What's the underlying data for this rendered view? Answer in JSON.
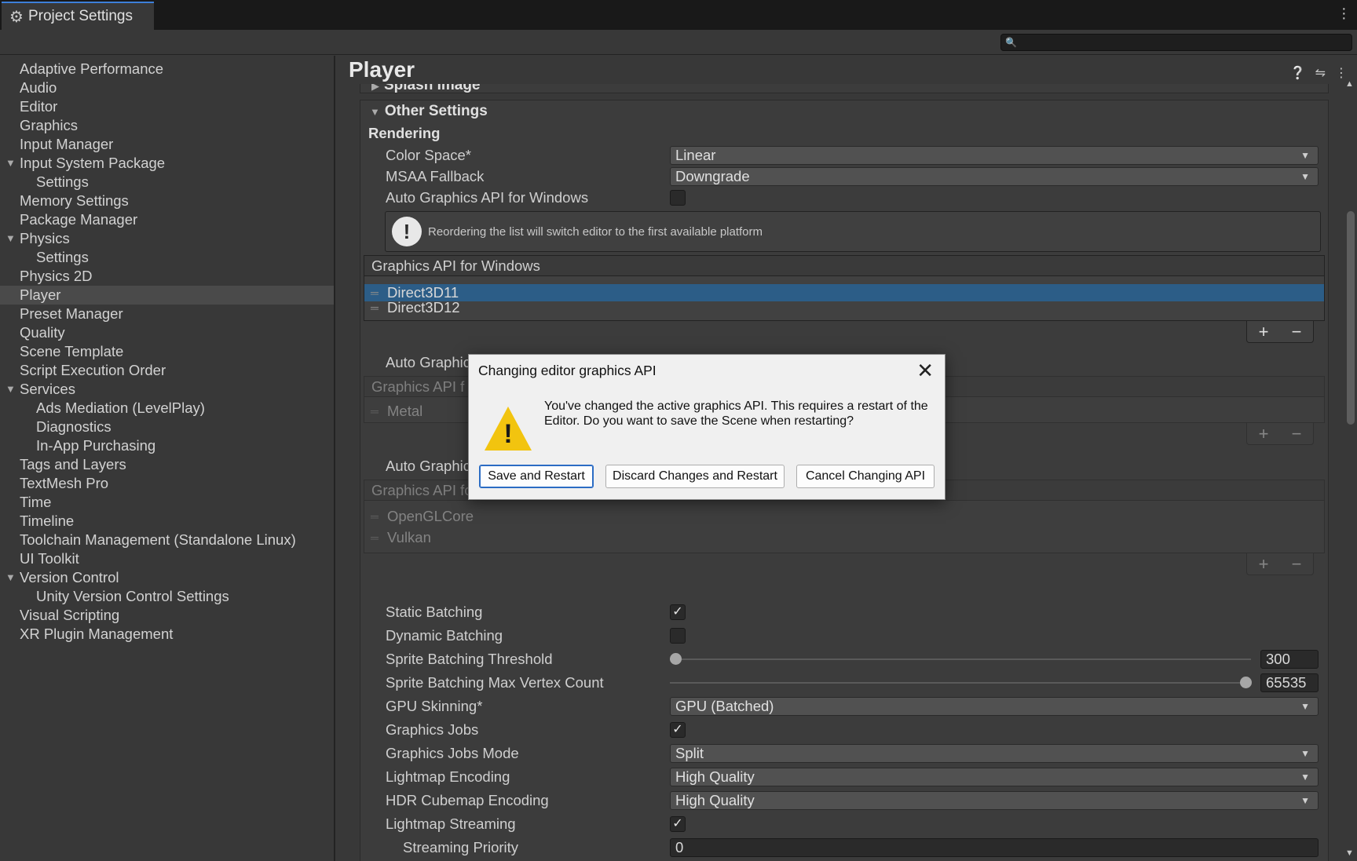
{
  "window": {
    "tab_title": "Project Settings",
    "tab_icon": "gear-icon"
  },
  "search": {
    "placeholder": ""
  },
  "sidebar": {
    "items": [
      {
        "label": "Adaptive Performance",
        "level": 0
      },
      {
        "label": "Audio",
        "level": 0
      },
      {
        "label": "Editor",
        "level": 0
      },
      {
        "label": "Graphics",
        "level": 0
      },
      {
        "label": "Input Manager",
        "level": 0
      },
      {
        "label": "Input System Package",
        "level": 0,
        "expanded": true
      },
      {
        "label": "Settings",
        "level": 1
      },
      {
        "label": "Memory Settings",
        "level": 0
      },
      {
        "label": "Package Manager",
        "level": 0
      },
      {
        "label": "Physics",
        "level": 0,
        "expanded": true
      },
      {
        "label": "Settings",
        "level": 1
      },
      {
        "label": "Physics 2D",
        "level": 0
      },
      {
        "label": "Player",
        "level": 0,
        "selected": true
      },
      {
        "label": "Preset Manager",
        "level": 0
      },
      {
        "label": "Quality",
        "level": 0
      },
      {
        "label": "Scene Template",
        "level": 0
      },
      {
        "label": "Script Execution Order",
        "level": 0
      },
      {
        "label": "Services",
        "level": 0,
        "expanded": true
      },
      {
        "label": "Ads Mediation (LevelPlay)",
        "level": 1
      },
      {
        "label": "Diagnostics",
        "level": 1
      },
      {
        "label": "In-App Purchasing",
        "level": 1
      },
      {
        "label": "Tags and Layers",
        "level": 0
      },
      {
        "label": "TextMesh Pro",
        "level": 0
      },
      {
        "label": "Time",
        "level": 0
      },
      {
        "label": "Timeline",
        "level": 0
      },
      {
        "label": "Toolchain Management (Standalone Linux)",
        "level": 0
      },
      {
        "label": "UI Toolkit",
        "level": 0
      },
      {
        "label": "Version Control",
        "level": 0,
        "expanded": true
      },
      {
        "label": "Unity Version Control Settings",
        "level": 1
      },
      {
        "label": "Visual Scripting",
        "level": 0
      },
      {
        "label": "XR Plugin Management",
        "level": 0
      }
    ]
  },
  "main": {
    "title": "Player",
    "splash_section": "Splash Image",
    "other_section": "Other Settings",
    "rendering_header": "Rendering",
    "color_space": {
      "label": "Color Space*",
      "value": "Linear"
    },
    "msaa": {
      "label": "MSAA Fallback",
      "value": "Downgrade"
    },
    "auto_win": {
      "label": "Auto Graphics API for Windows"
    },
    "help": "Reordering the list will switch editor to the first available platform",
    "win_list": {
      "header": "Graphics API for Windows",
      "items": [
        "Direct3D11",
        "Direct3D12"
      ]
    },
    "auto_mac_label": "Auto Graphic",
    "mac_list": {
      "header": "Graphics API f",
      "items": [
        "Metal"
      ]
    },
    "auto_linux_label": "Auto Graphic",
    "linux_list": {
      "header": "Graphics API for Linux",
      "items": [
        "OpenGLCore",
        "Vulkan"
      ]
    },
    "static_batching": "Static Batching",
    "dynamic_batching": "Dynamic Batching",
    "sprite_threshold": {
      "label": "Sprite Batching Threshold",
      "value": "300"
    },
    "sprite_max_vertex": {
      "label": "Sprite Batching Max Vertex Count",
      "value": "65535"
    },
    "gpu_skinning": {
      "label": "GPU Skinning*",
      "value": "GPU (Batched)"
    },
    "graphics_jobs": "Graphics Jobs",
    "graphics_jobs_mode": {
      "label": "Graphics Jobs Mode",
      "value": "Split"
    },
    "lightmap_encoding": {
      "label": "Lightmap Encoding",
      "value": "High Quality"
    },
    "hdr_cubemap": {
      "label": "HDR Cubemap Encoding",
      "value": "High Quality"
    },
    "lightmap_streaming": "Lightmap Streaming",
    "streaming_priority": {
      "label": "Streaming Priority",
      "value": "0"
    },
    "checkmark": "✓"
  },
  "dialog": {
    "title": "Changing editor graphics API",
    "message": "You've changed the active graphics API. This requires a restart of the Editor. Do you want to save the Scene when restarting?",
    "save_label": "Save and Restart",
    "discard_label": "Discard Changes and Restart",
    "cancel_label": "Cancel Changing API"
  }
}
